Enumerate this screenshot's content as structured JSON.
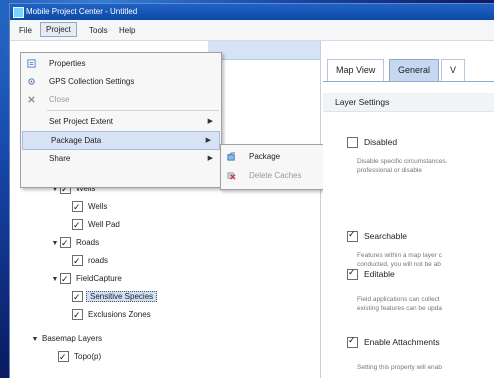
{
  "window": {
    "title": "Mobile Project Center - Untitled"
  },
  "menubar": [
    "File",
    "Project",
    "Tools",
    "Help"
  ],
  "project_menu": [
    {
      "label": "Properties",
      "icon": "properties-icon",
      "enabled": true
    },
    {
      "label": "GPS Collection Settings",
      "icon": "gps-icon",
      "enabled": true
    },
    {
      "label": "Close",
      "icon": "close-project-icon",
      "enabled": false
    },
    {
      "label": "Set Project Extent",
      "icon": "",
      "enabled": true,
      "submenu": true
    },
    {
      "label": "Package Data",
      "icon": "",
      "enabled": true,
      "submenu": true,
      "highlighted": true
    },
    {
      "label": "Share",
      "icon": "",
      "enabled": true,
      "submenu": true
    }
  ],
  "package_submenu": [
    {
      "label": "Package",
      "icon": "package-icon",
      "enabled": true
    },
    {
      "label": "Delete Caches",
      "icon": "delete-caches-icon",
      "enabled": false
    }
  ],
  "tree": [
    {
      "label": "Wells",
      "level": 1,
      "expanded": true
    },
    {
      "label": "Wells",
      "level": 2
    },
    {
      "label": "Well Pad",
      "level": 2
    },
    {
      "label": "Roads",
      "level": 1,
      "expanded": true
    },
    {
      "label": "roads",
      "level": 2
    },
    {
      "label": "FieldCapture",
      "level": 1,
      "expanded": true
    },
    {
      "label": "Sensitive Species",
      "level": 2,
      "selected": true
    },
    {
      "label": "Exclusions Zones",
      "level": 2
    },
    {
      "label": "Basemap Layers",
      "level": 0,
      "expanded": true
    },
    {
      "label": "Topo(p)",
      "level": 1
    }
  ],
  "tabs": [
    "Map View",
    "General",
    "V"
  ],
  "active_tab": "General",
  "section_title": "Layer Settings",
  "options": [
    {
      "label": "Disabled",
      "checked": false,
      "desc": [
        "Disable specific circumstances.",
        "professional or disable"
      ]
    },
    {
      "label": "Searchable",
      "checked": true,
      "desc": [
        "Features within a map layer c",
        "conducted, you will not be ab"
      ]
    },
    {
      "label": "Editable",
      "checked": true,
      "desc": [
        "Field applications can collect",
        "existing features can be upda"
      ]
    },
    {
      "label": "Enable Attachments",
      "checked": true,
      "desc": [
        "Setting this property will enab"
      ]
    }
  ]
}
